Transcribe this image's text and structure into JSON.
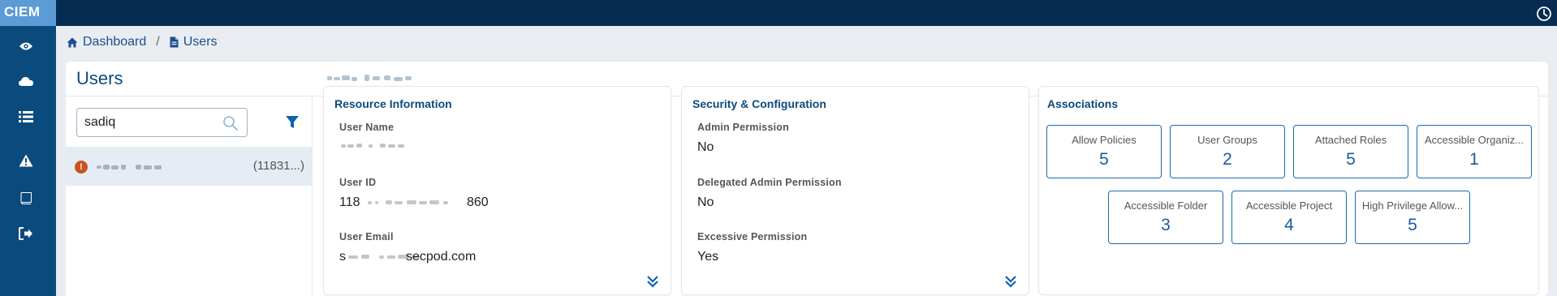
{
  "app": {
    "logo": "CIEM"
  },
  "sidebar": {
    "items": [
      {
        "icon": "eye-icon"
      },
      {
        "icon": "cloud-icon"
      },
      {
        "icon": "list-icon"
      },
      {
        "icon": "warning-icon"
      },
      {
        "icon": "book-icon"
      },
      {
        "icon": "sign-out-icon"
      }
    ]
  },
  "breadcrumb": {
    "home": "Dashboard",
    "separator": "/",
    "current": "Users"
  },
  "page": {
    "title": "Users"
  },
  "search": {
    "value": "sadiq"
  },
  "list": {
    "items": [
      {
        "id_text": "(11831...)",
        "status": "warning"
      }
    ]
  },
  "resource_info": {
    "title": "Resource Information",
    "user_name_label": "User Name",
    "user_id_label": "User ID",
    "user_id_prefix": "118",
    "user_id_suffix": "860",
    "user_email_label": "User Email",
    "user_email_prefix": "s",
    "user_email_suffix": "secpod.com"
  },
  "security": {
    "title": "Security & Configuration",
    "admin_label": "Admin Permission",
    "admin_value": "No",
    "delegated_label": "Delegated Admin Permission",
    "delegated_value": "No",
    "excessive_label": "Excessive Permission",
    "excessive_value": "Yes"
  },
  "associations": {
    "title": "Associations",
    "tiles": [
      {
        "label": "Allow Policies",
        "value": "5"
      },
      {
        "label": "User Groups",
        "value": "2"
      },
      {
        "label": "Attached Roles",
        "value": "5"
      },
      {
        "label": "Accessible Organiz...",
        "value": "1"
      },
      {
        "label": "Accessible Folder",
        "value": "3"
      },
      {
        "label": "Accessible Project",
        "value": "4"
      },
      {
        "label": "High Privilege Allow...",
        "value": "5"
      }
    ]
  },
  "colors": {
    "topbar": "#062c52",
    "sidebar": "#0b4a7d",
    "logo_bg": "#5b9bd6",
    "accent": "#1a6ab0",
    "warning": "#c8531f"
  }
}
